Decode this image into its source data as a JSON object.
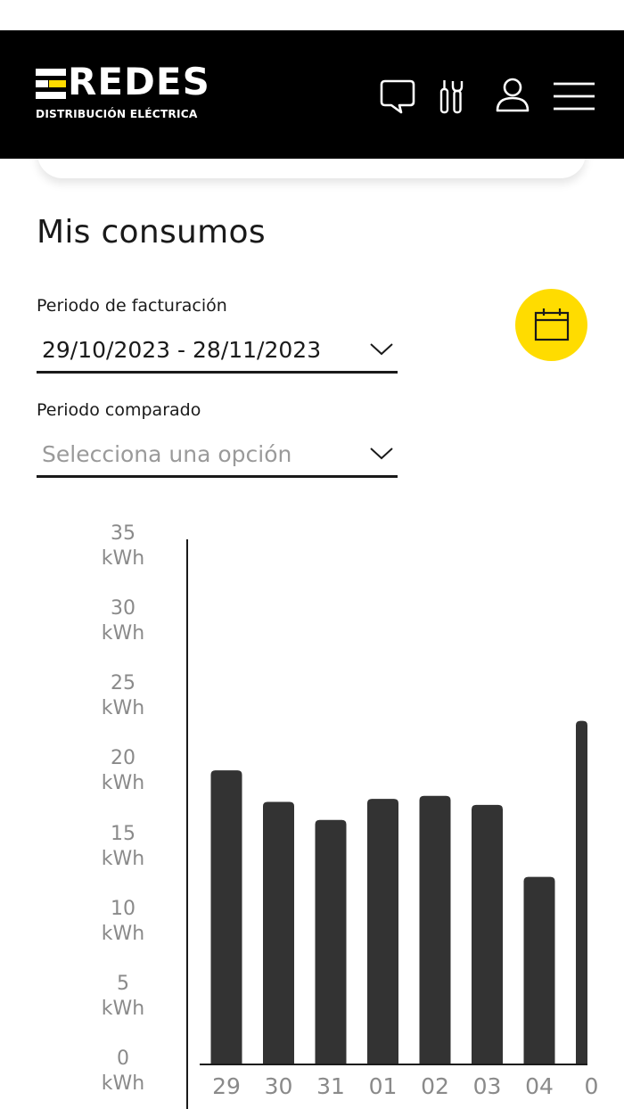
{
  "brand": {
    "name": "REDES",
    "tagline": "DISTRIBUCIÓN ELÉCTRICA",
    "accent": "#ffdc00"
  },
  "header": {
    "icons": [
      "chat-icon",
      "tools-icon",
      "user-icon",
      "menu-icon"
    ]
  },
  "page": {
    "title": "Mis consumos"
  },
  "billing": {
    "label": "Periodo de facturación",
    "value": "29/10/2023 - 28/11/2023"
  },
  "compare": {
    "label": "Periodo comparado",
    "placeholder": "Selecciona una opción"
  },
  "calendar": {
    "icon": "calendar-icon"
  },
  "chart_data": {
    "type": "bar",
    "categories": [
      "29",
      "30",
      "31",
      "01",
      "02",
      "03",
      "04",
      "0"
    ],
    "values": [
      19.6,
      17.5,
      16.3,
      17.7,
      17.9,
      17.3,
      12.5,
      22.9
    ],
    "ylim": [
      0,
      35
    ],
    "yticks": [
      {
        "value": 35,
        "label": "35",
        "unit": "kWh"
      },
      {
        "value": 30,
        "label": "30",
        "unit": "kWh"
      },
      {
        "value": 25,
        "label": "25",
        "unit": "kWh"
      },
      {
        "value": 20,
        "label": "20",
        "unit": "kWh"
      },
      {
        "value": 15,
        "label": "15",
        "unit": "kWh"
      },
      {
        "value": 10,
        "label": "10",
        "unit": "kWh"
      },
      {
        "value": 5,
        "label": "5",
        "unit": "kWh"
      },
      {
        "value": 0,
        "label": "0",
        "unit": "kWh"
      }
    ],
    "bar_color": "#333333",
    "grid": false
  }
}
